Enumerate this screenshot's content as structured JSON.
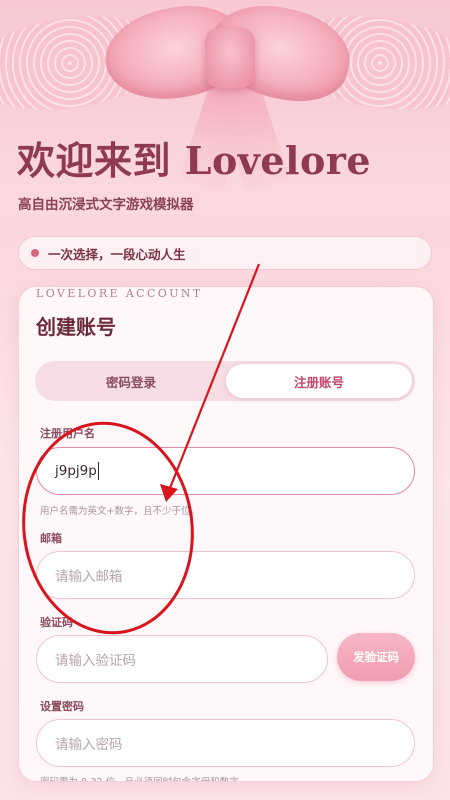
{
  "hero": {
    "title": "欢迎来到 Lovelore",
    "subtitle": "高自由沉浸式文字游戏模拟器"
  },
  "slogan": {
    "text": "一次选择，一段心动人生"
  },
  "card": {
    "kicker": "LOVELORE ACCOUNT",
    "title": "创建账号",
    "tabs": [
      {
        "label": "密码登录",
        "active": false
      },
      {
        "label": "注册账号",
        "active": true
      }
    ]
  },
  "form": {
    "username": {
      "label": "注册用户名",
      "value": "j9pj9p",
      "hint": "用户名需为英文+数字，且不少于位。"
    },
    "email": {
      "label": "邮箱",
      "placeholder": "请输入邮箱"
    },
    "code": {
      "label": "验证码",
      "placeholder": "请输入验证码",
      "button": "发验证码"
    },
    "password": {
      "label": "设置密码",
      "placeholder": "请输入密码",
      "hint": "密码需为 8-32 位，且必须同时包含字母和数字。"
    }
  },
  "colors": {
    "accent": "#c4476a",
    "annotation": "#d8141e"
  }
}
